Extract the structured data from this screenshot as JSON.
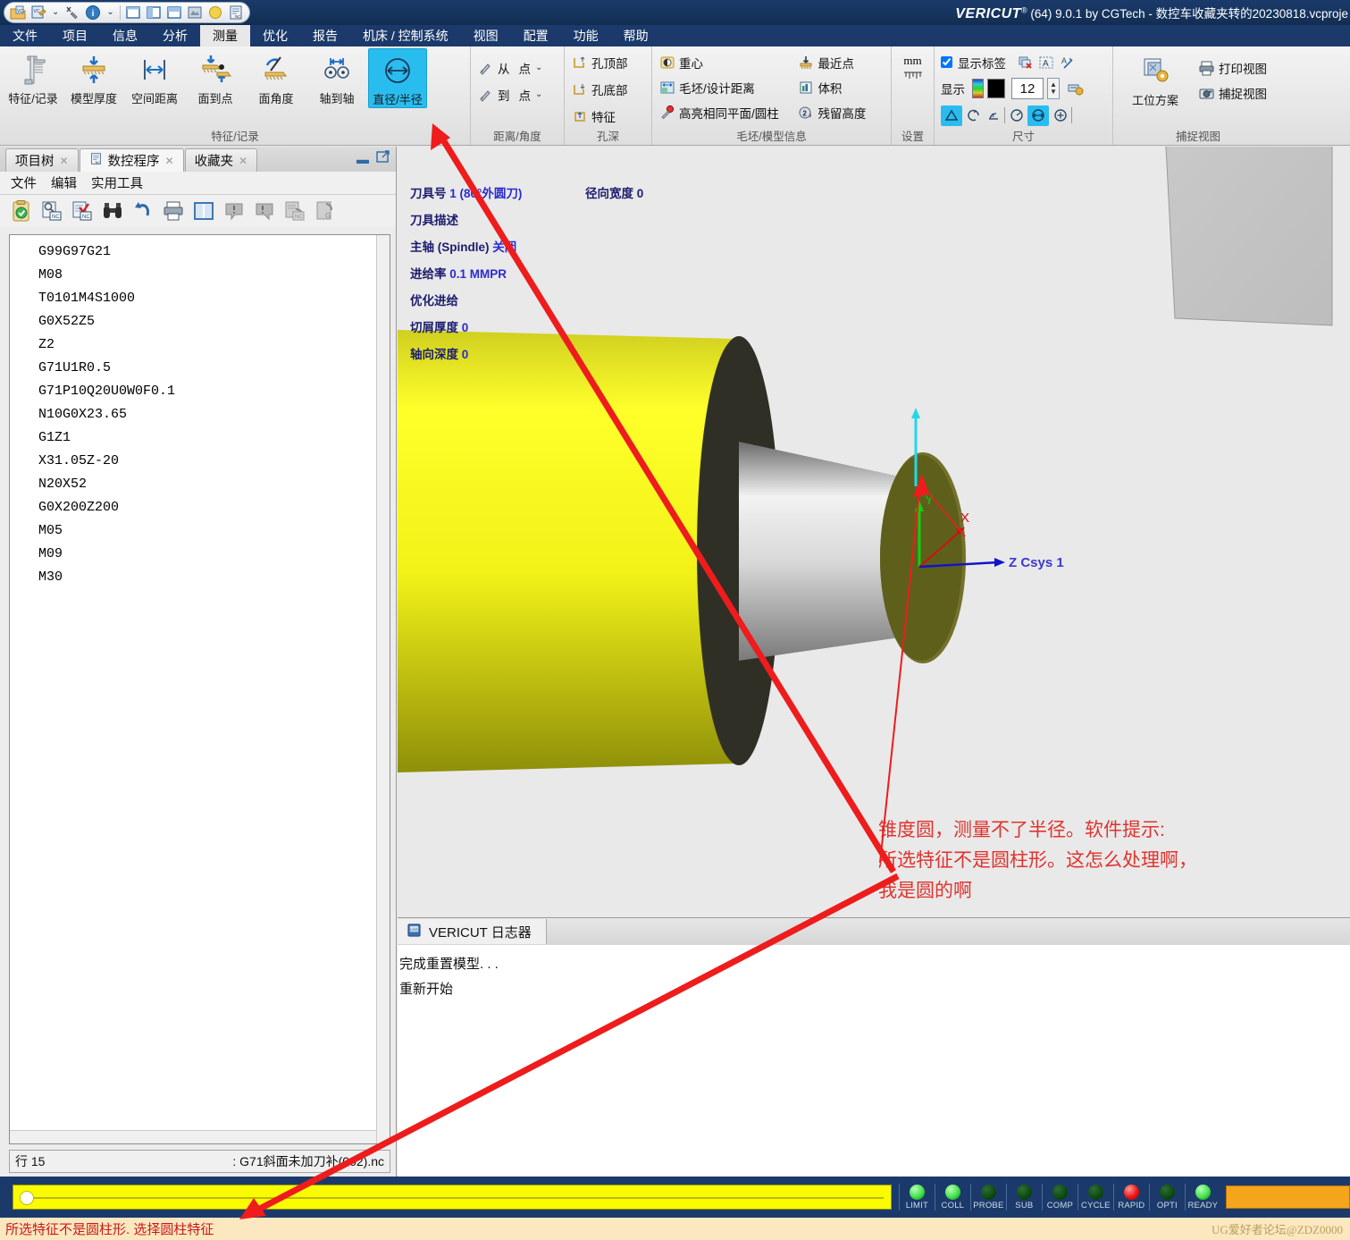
{
  "titlebar": {
    "logo": "VERICUT",
    "title_suffix": "(64)  9.0.1 by CGTech - 数控车收藏夹转的20230818.vcproje",
    "quick_icons": [
      "open-project-icon",
      "save-project-icon",
      "chevron-down-icon",
      "tool-manager-icon",
      "info-icon",
      "chevron-down-icon",
      "single-view-icon",
      "two-view-vertical-icon",
      "two-view-horizontal-icon",
      "machine-view-icon",
      "sphere-view-icon",
      "nc-program-icon"
    ]
  },
  "menubar": {
    "items": [
      {
        "label": "文件"
      },
      {
        "label": "项目"
      },
      {
        "label": "信息"
      },
      {
        "label": "分析"
      },
      {
        "label": "测量",
        "active": true
      },
      {
        "label": "优化"
      },
      {
        "label": "报告"
      },
      {
        "label": "机床 / 控制系统"
      },
      {
        "label": "视图"
      },
      {
        "label": "配置"
      },
      {
        "label": "功能"
      },
      {
        "label": "帮助"
      }
    ]
  },
  "ribbon": {
    "groups": [
      {
        "title": "特征/记录",
        "buttons": [
          {
            "label": "特征/记录",
            "icon": "caliper-icon",
            "selected": false
          },
          {
            "label": "模型厚度",
            "icon": "thickness-icon",
            "selected": false
          },
          {
            "label": "空间距离",
            "icon": "span-distance-icon",
            "selected": false
          },
          {
            "label": "面到点",
            "icon": "face-to-point-icon",
            "selected": false
          },
          {
            "label": "面角度",
            "icon": "face-angle-icon",
            "selected": false
          },
          {
            "label": "轴到轴",
            "icon": "axis-to-axis-icon",
            "selected": false
          },
          {
            "label": "直径/半径",
            "icon": "diameter-radius-icon",
            "selected": true
          }
        ]
      },
      {
        "title": "距离/角度",
        "rows": [
          {
            "icon": "pick-from-icon",
            "label": "从",
            "value": "点",
            "dropdown": true
          },
          {
            "icon": "pick-to-icon",
            "label": "到",
            "value": "点",
            "dropdown": true
          }
        ]
      },
      {
        "title": "孔深",
        "rows": [
          {
            "icon": "hole-top-icon",
            "label": "孔顶部"
          },
          {
            "icon": "hole-bottom-icon",
            "label": "孔底部"
          },
          {
            "icon": "feature-icon",
            "label": "特征"
          }
        ]
      },
      {
        "title": "毛坯/模型信息",
        "colA": [
          {
            "icon": "center-of-gravity-icon",
            "label": "重心"
          },
          {
            "icon": "stock-design-distance-icon",
            "label": "毛坯/设计距离"
          },
          {
            "icon": "highlight-same-plane-icon",
            "label": "高亮相同平面/圆柱"
          }
        ],
        "colB": [
          {
            "icon": "nearest-point-icon",
            "label": "最近点"
          },
          {
            "icon": "volume-icon",
            "label": "体积"
          },
          {
            "icon": "residual-height-icon",
            "label": "残留高度"
          }
        ]
      },
      {
        "title": "设置",
        "unit": "mm",
        "unit_icon": "ruler-mm-icon"
      },
      {
        "title": "尺寸",
        "show_label_checkbox": {
          "label": "显示标签",
          "checked": true
        },
        "row1_icons": [
          "delete-label-icon",
          "text-box-icon",
          "text-edit-icon"
        ],
        "display_label": "显示",
        "color_swatch": "#000000",
        "font_size": "12",
        "spinner_icon": "spinner-icon",
        "label_settings_icon": "label-settings-icon",
        "dim_icons": [
          {
            "name": "triangle-dim-icon",
            "selected": true
          },
          {
            "name": "arc-dim-icon",
            "selected": false
          },
          {
            "name": "angle-dim-icon",
            "selected": false
          },
          {
            "name": "divider",
            "selected": false
          },
          {
            "name": "clock-dim-icon",
            "selected": false
          },
          {
            "name": "diameter-dim-icon",
            "selected": true
          },
          {
            "name": "point-dim-icon",
            "selected": false
          },
          {
            "name": "divider",
            "selected": false
          }
        ]
      },
      {
        "title": "捕捉视图",
        "big": {
          "label": "工位方案",
          "icon": "workstation-scheme-icon"
        },
        "rows": [
          {
            "icon": "printer-icon",
            "label": "打印视图"
          },
          {
            "icon": "camera-icon",
            "label": "捕捉视图"
          }
        ]
      }
    ]
  },
  "leftpanel": {
    "tabs": [
      {
        "label": "项目树",
        "icon": "project-tree-icon",
        "selected": false,
        "closable": true
      },
      {
        "label": "数控程序",
        "icon": "nc-program-icon",
        "selected": true,
        "closable": true
      },
      {
        "label": "收藏夹",
        "icon": "favorites-icon",
        "selected": false,
        "closable": true
      }
    ],
    "minimize_icon": "minimize-icon",
    "float_icon": "float-window-icon",
    "menu": [
      "文件",
      "编辑",
      "实用工具"
    ],
    "toolbar_icons": [
      "clipboard-check-icon",
      "search-nc-icon",
      "verify-nc-icon",
      "binoculars-icon",
      "undo-icon",
      "print-icon",
      "split-view-icon",
      "prev-error-icon",
      "next-error-icon",
      "nc-back-icon",
      "g-code-icon"
    ],
    "code_lines": [
      "G99G97G21",
      "M08",
      "T0101M4S1000",
      "G0X52Z5",
      "Z2",
      "G71U1R0.5",
      "G71P10Q20U0W0F0.1",
      "N10G0X23.65",
      "G1Z1",
      "X31.05Z-20",
      "N20X52",
      "G0X200Z200",
      "M05",
      "M09",
      "M30"
    ],
    "current_line_index": 14,
    "status_left": "行 15",
    "status_right": ": G71斜面未加刀补(002).nc"
  },
  "viewport": {
    "info_left": [
      {
        "label": "刀具号",
        "value": "1 (80°外圆刀)"
      },
      {
        "label": "刀具描述",
        "value": ""
      },
      {
        "label": "主轴 (Spindle)",
        "value": "关闭"
      },
      {
        "label": "进给率",
        "value": "0.1 MMPR"
      },
      {
        "label": "优化进给",
        "value": ""
      },
      {
        "label": "切屑厚度",
        "value": "0"
      },
      {
        "label": "轴向深度",
        "value": "0"
      }
    ],
    "info_right": [
      {
        "label": "径向宽度",
        "value": "0"
      }
    ],
    "csys_label": "Z Csys 1",
    "axis_labels": {
      "x": "X",
      "y": "Y"
    },
    "annotation": "锥度圆，测量不了半径。软件提示:\n所选特征不是圆柱形。这怎么处理啊，\n我是圆的啊"
  },
  "logpanel": {
    "tab_label": "VERICUT 日志器",
    "tab_icon": "log-icon",
    "lines": [
      "完成重置模型. . .",
      "重新开始"
    ]
  },
  "bottombar": {
    "leds": [
      {
        "label": "LIMIT",
        "color": "#44e24a"
      },
      {
        "label": "COLL",
        "color": "#44e24a"
      },
      {
        "label": "PROBE",
        "color": "#0b4a10"
      },
      {
        "label": "SUB",
        "color": "#0b4a10"
      },
      {
        "label": "COMP",
        "color": "#0b4a10"
      },
      {
        "label": "CYCLE",
        "color": "#0b4a10"
      },
      {
        "label": "RAPID",
        "color": "#f01414"
      },
      {
        "label": "OPTI",
        "color": "#0b4a10"
      },
      {
        "label": "READY",
        "color": "#44e24a"
      }
    ],
    "progress_color": "#fbfb00",
    "orange_color": "#f5a51c"
  },
  "errorbar": {
    "message": "所选特征不是圆柱形. 选择圆柱特征",
    "watermark": "UG爱好者论坛@ZDZ0000"
  }
}
